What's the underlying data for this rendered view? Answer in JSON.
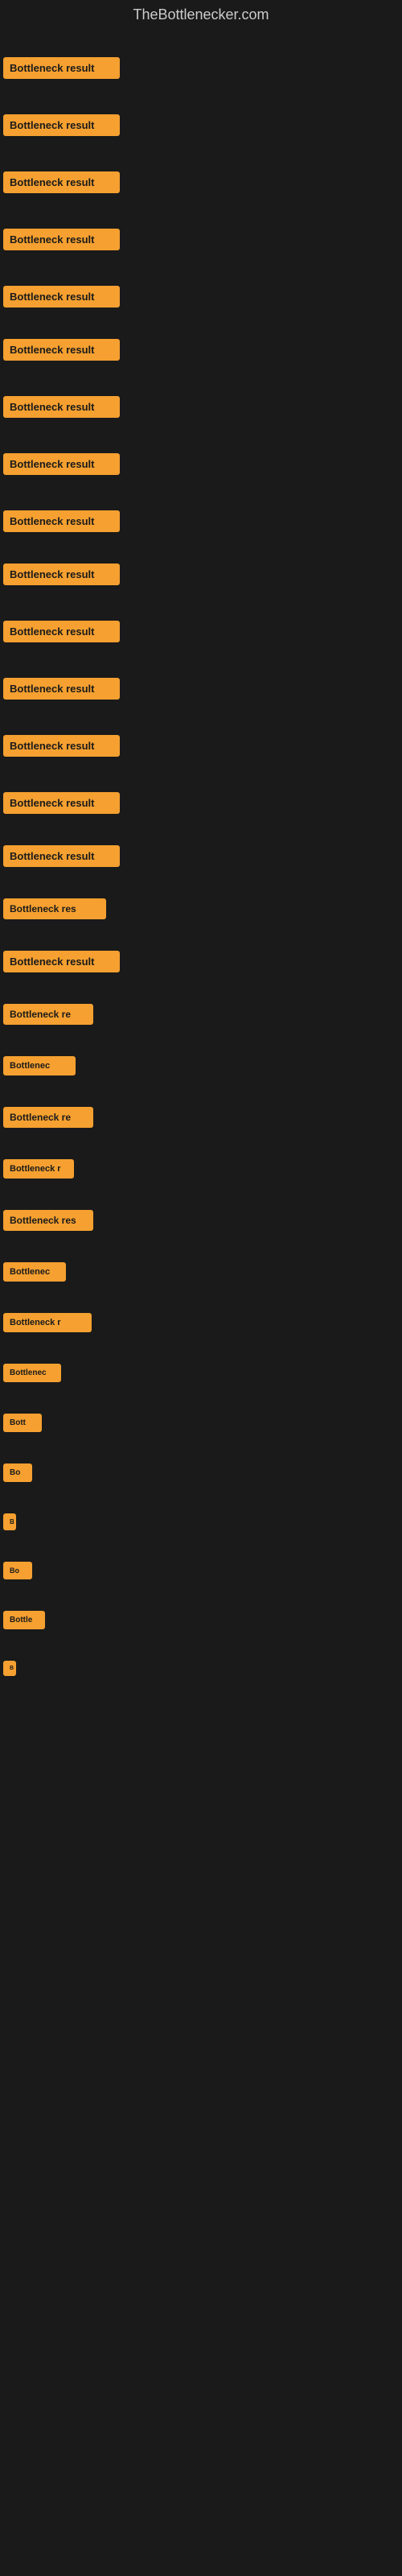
{
  "site": {
    "title": "TheBottlenecker.com"
  },
  "items": [
    {
      "label": "Bottleneck result",
      "width": 145,
      "fontSize": 13,
      "paddingTop": 30
    },
    {
      "label": "Bottleneck result",
      "width": 145,
      "fontSize": 13,
      "paddingTop": 35
    },
    {
      "label": "Bottleneck result",
      "width": 145,
      "fontSize": 13,
      "paddingTop": 35
    },
    {
      "label": "Bottleneck result",
      "width": 145,
      "fontSize": 13,
      "paddingTop": 35
    },
    {
      "label": "Bottleneck result",
      "width": 145,
      "fontSize": 13,
      "paddingTop": 35
    },
    {
      "label": "Bottleneck result",
      "width": 145,
      "fontSize": 13,
      "paddingTop": 30
    },
    {
      "label": "Bottleneck result",
      "width": 145,
      "fontSize": 13,
      "paddingTop": 35
    },
    {
      "label": "Bottleneck result",
      "width": 145,
      "fontSize": 13,
      "paddingTop": 35
    },
    {
      "label": "Bottleneck result",
      "width": 145,
      "fontSize": 13,
      "paddingTop": 35
    },
    {
      "label": "Bottleneck result",
      "width": 145,
      "fontSize": 13,
      "paddingTop": 30
    },
    {
      "label": "Bottleneck result",
      "width": 145,
      "fontSize": 13,
      "paddingTop": 35
    },
    {
      "label": "Bottleneck result",
      "width": 145,
      "fontSize": 13,
      "paddingTop": 35
    },
    {
      "label": "Bottleneck result",
      "width": 145,
      "fontSize": 13,
      "paddingTop": 35
    },
    {
      "label": "Bottleneck result",
      "width": 145,
      "fontSize": 13,
      "paddingTop": 35
    },
    {
      "label": "Bottleneck result",
      "width": 145,
      "fontSize": 13,
      "paddingTop": 30
    },
    {
      "label": "Bottleneck res",
      "width": 128,
      "fontSize": 12,
      "paddingTop": 30
    },
    {
      "label": "Bottleneck result",
      "width": 145,
      "fontSize": 13,
      "paddingTop": 30
    },
    {
      "label": "Bottleneck re",
      "width": 112,
      "fontSize": 12,
      "paddingTop": 30
    },
    {
      "label": "Bottlenec",
      "width": 90,
      "fontSize": 11,
      "paddingTop": 30
    },
    {
      "label": "Bottleneck re",
      "width": 112,
      "fontSize": 12,
      "paddingTop": 30
    },
    {
      "label": "Bottleneck r",
      "width": 88,
      "fontSize": 11,
      "paddingTop": 30
    },
    {
      "label": "Bottleneck res",
      "width": 112,
      "fontSize": 12,
      "paddingTop": 30
    },
    {
      "label": "Bottlenec",
      "width": 78,
      "fontSize": 11,
      "paddingTop": 30
    },
    {
      "label": "Bottleneck r",
      "width": 110,
      "fontSize": 11,
      "paddingTop": 30
    },
    {
      "label": "Bottlenec",
      "width": 72,
      "fontSize": 10,
      "paddingTop": 30
    },
    {
      "label": "Bott",
      "width": 48,
      "fontSize": 10,
      "paddingTop": 30
    },
    {
      "label": "Bo",
      "width": 36,
      "fontSize": 10,
      "paddingTop": 30
    },
    {
      "label": "B",
      "width": 14,
      "fontSize": 8,
      "paddingTop": 30
    },
    {
      "label": "Bo",
      "width": 36,
      "fontSize": 9,
      "paddingTop": 30
    },
    {
      "label": "Bottle",
      "width": 52,
      "fontSize": 10,
      "paddingTop": 30
    },
    {
      "label": "B",
      "width": 12,
      "fontSize": 7,
      "paddingTop": 30
    }
  ],
  "colors": {
    "badge_bg": "#f5a030",
    "badge_text": "#1a1a1a",
    "background": "#1a1a1a",
    "title": "#cccccc"
  }
}
